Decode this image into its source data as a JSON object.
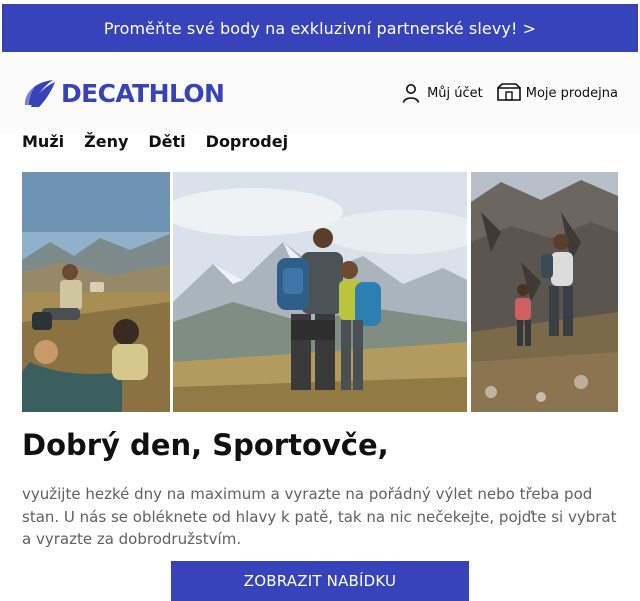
{
  "promo": {
    "text": "Proměňte své body na exkluzivní partnerské slevy! >"
  },
  "brand": {
    "name": "DECATHLON",
    "color": "#3643ba"
  },
  "header": {
    "account_label": "Můj účet",
    "account_icon": "user-icon",
    "store_label": "Moje prodejna",
    "store_icon": "store-icon"
  },
  "nav": {
    "items": [
      "Muži",
      "Ženy",
      "Děti",
      "Doprodej"
    ]
  },
  "hero": {
    "photos": [
      "hikers-resting-meadow-photo",
      "father-son-mountain-view-photo",
      "hikers-rocky-trail-photo"
    ]
  },
  "content": {
    "greeting": "Dobrý den, Sportovče,",
    "body": "využijte hezké dny na maximum a vyrazte na pořádný výlet nebo třeba pod stan. U nás se obléknete od hlavy k patě, tak na nic nečekejte, pojďte si vybrat a vyrazte za dobrodružstvím.",
    "cta_label": "ZOBRAZIT NABÍDKU"
  }
}
